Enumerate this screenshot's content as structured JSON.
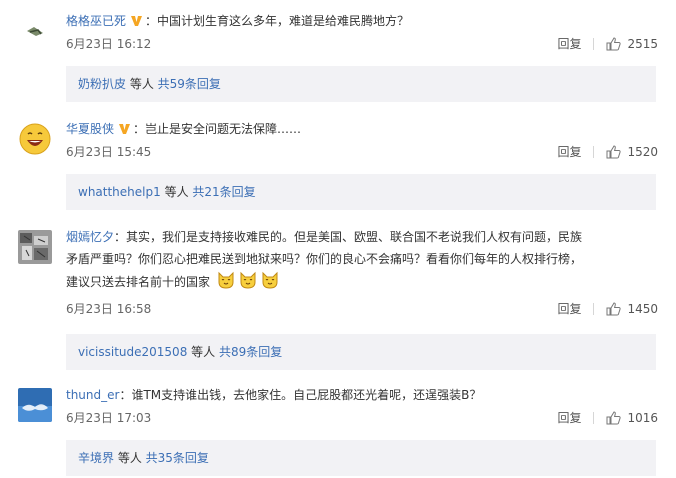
{
  "comments": [
    {
      "user": "格格巫已死",
      "text": "：中国计划生育这么多年，难道是给难民腾地方？",
      "time": "6月23日 16:12",
      "reply_label": "回复",
      "likes": "2515",
      "reply_user": "奶粉扒皮",
      "reply_mid": " 等人 ",
      "reply_count": "共59条回复"
    },
    {
      "user": "华夏股侠",
      "text": "：岂止是安全问题无法保障……",
      "time": "6月23日 15:45",
      "reply_label": "回复",
      "likes": "1520",
      "reply_user": "whatthehelp1",
      "reply_mid": " 等人 ",
      "reply_count": "共21条回复"
    },
    {
      "user": "烟嫣忆夕",
      "text_line1": "：其实，我们是支持接收难民的。但是美国、欧盟、联合国不老说我们人权有问题，民族",
      "text_line2": "矛盾严重吗？你们忍心把难民送到地狱来吗？你们的良心不会痛吗？看看你们每年的人权排行榜，",
      "text_line3": "建议只送去排名前十的国家",
      "time": "6月23日 16:58",
      "reply_label": "回复",
      "likes": "1450",
      "reply_user": "vicissitude201508",
      "reply_mid": " 等人 ",
      "reply_count": "共89条回复"
    },
    {
      "user": "thund_er",
      "text": "：谁TM支持谁出钱，去他家住。自己屁股都还光着呢，还逞强装B？",
      "time": "6月23日 17:03",
      "reply_label": "回复",
      "likes": "1016",
      "reply_user": "辛境界",
      "reply_mid": " 等人 ",
      "reply_count": "共35条回复"
    }
  ],
  "colors": {
    "link": "#3c6fb5",
    "vip_badge": "#f5a623",
    "reply_box_bg": "#f2f2f5"
  },
  "icons": [
    "avatar-image",
    "vip-badge-icon",
    "thumbs-up-icon",
    "cat-emoji-icon"
  ]
}
